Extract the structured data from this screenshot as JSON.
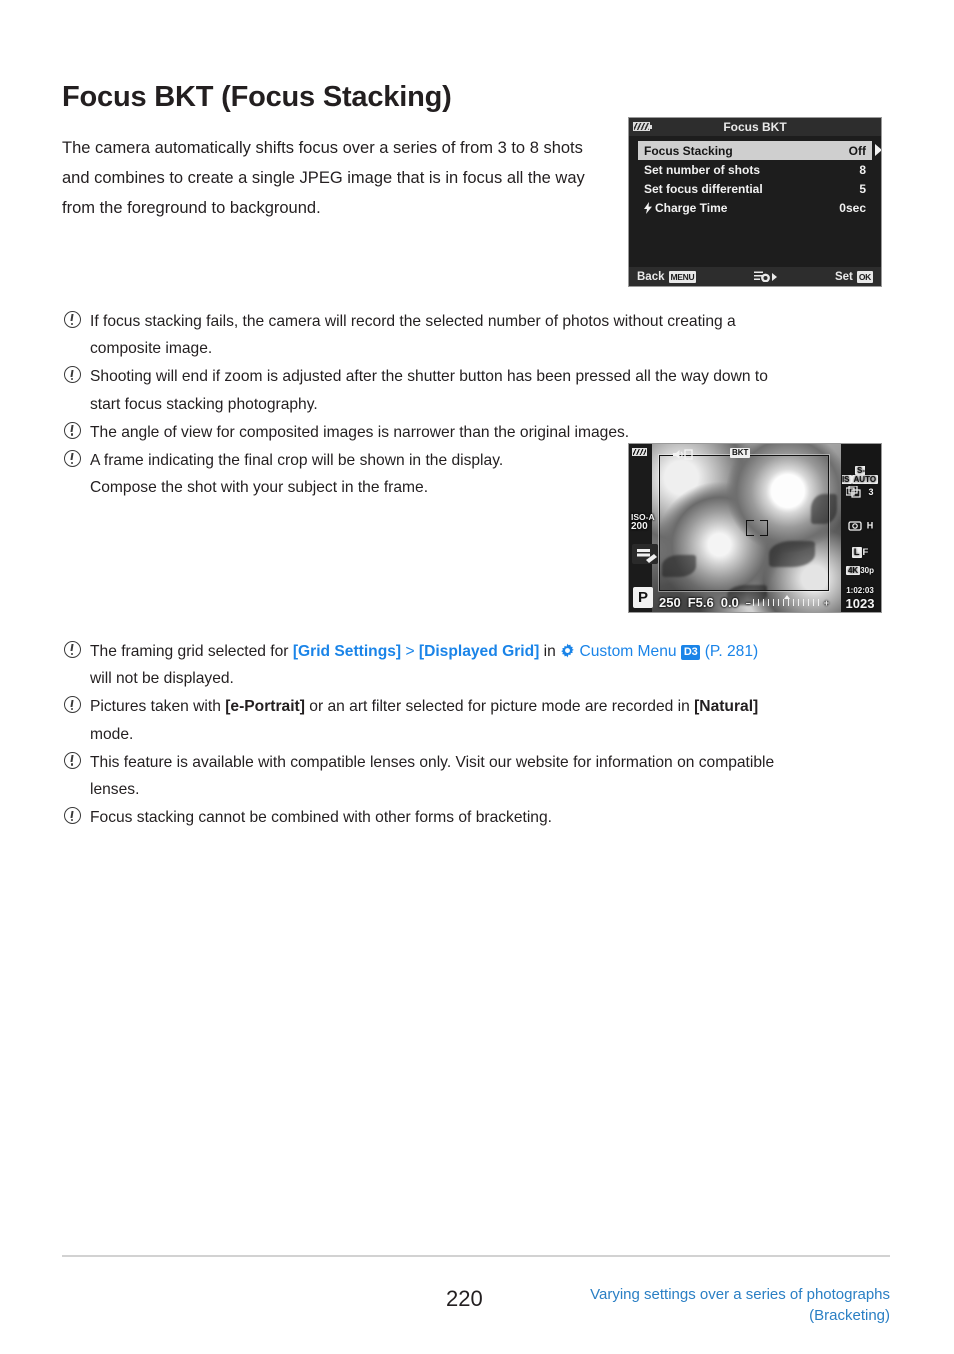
{
  "page": {
    "title": "Focus BKT (Focus Stacking)",
    "intro": "The camera automatically shifts focus over a series of from 3 to 8 shots and combines to create a single JPEG image that is in focus all the way from the foreground to background.",
    "number": "220",
    "footer_line1": "Varying settings over a series of photographs",
    "footer_line2": "(Bracketing)"
  },
  "notes_top": [
    {
      "line1": "If focus stacking fails, the camera will record the selected number of photos without creating a",
      "line2": "composite image."
    },
    {
      "line1": "Shooting will end if zoom is adjusted after the shutter button has been pressed all the way down to",
      "line2": "start focus stacking photography."
    },
    {
      "line1": "The angle of view for composited images is narrower than the original images.",
      "line2": ""
    },
    {
      "line1": "A frame indicating the final crop will be shown in the display.",
      "line2": "Compose the shot with your subject in the frame."
    }
  ],
  "notes_bottom": {
    "grid_note": {
      "prefix": "The framing grid selected for ",
      "link1": "[Grid Settings]",
      "sep": " > ",
      "link2": "[Displayed Grid]",
      "mid": " in ",
      "menu_label": "Custom Menu",
      "badge": "D3",
      "page_ref": "(P. 281)",
      "line2": "will not be displayed."
    },
    "portrait_note": {
      "prefix": "Pictures taken with ",
      "bold1": "[e-Portrait]",
      "mid": " or an art filter selected for picture mode are recorded in ",
      "bold2": "[Natural]",
      "line2": "mode."
    },
    "lens_note": {
      "line1": "This feature is available with compatible lenses only. Visit our website for information on compatible",
      "line2": "lenses."
    },
    "bracket_note": {
      "line1": "Focus stacking cannot be combined with other forms of bracketing.",
      "line2": ""
    }
  },
  "camera_menu": {
    "title": "Focus BKT",
    "rows": [
      {
        "label": "Focus Stacking",
        "value": "Off",
        "selected": true,
        "flash": false
      },
      {
        "label": "Set number of shots",
        "value": "8",
        "selected": false,
        "flash": false
      },
      {
        "label": "Set focus differential",
        "value": "5",
        "selected": false,
        "flash": false
      },
      {
        "label": "Charge Time",
        "value": "0sec",
        "selected": false,
        "flash": true
      }
    ],
    "footer": {
      "back_label": "Back",
      "back_key": "MENU",
      "set_label": "Set",
      "set_key": "OK"
    }
  },
  "live_view": {
    "iso_label": "ISO-A",
    "iso_value": "200",
    "mode": "P",
    "bkt_top": "BKT",
    "stabilizer": "S-IS",
    "stabilizer_mode": "AUTO",
    "bkt_right": "BKT",
    "bkt_right_num": "3",
    "drive": "H",
    "quality_chip": "L",
    "quality_suffix": "F",
    "movie_chip": "4K",
    "movie_rate": "30p",
    "record_time": "1:02:03",
    "frames_remaining": "1023",
    "shutter": "250",
    "aperture": "F5.6",
    "exposure_comp": "0.0",
    "scale_minus": "–",
    "scale_plus": "+"
  },
  "colors": {
    "link_blue": "#1a84e8",
    "footer_blue": "#2a7fc4",
    "text": "#231f20"
  }
}
